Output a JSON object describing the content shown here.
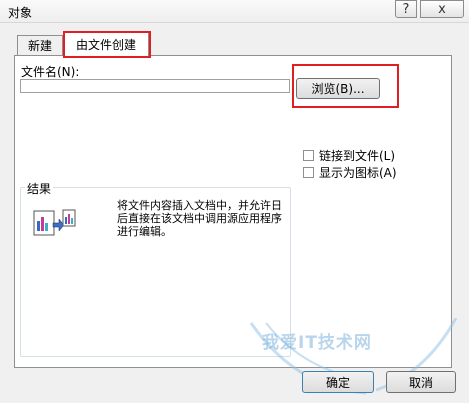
{
  "window": {
    "title": "对象",
    "help_label": "?",
    "close_label": "x"
  },
  "tabs": [
    {
      "label": "新建"
    },
    {
      "label": "由文件创建"
    }
  ],
  "file": {
    "label": "文件名(N):",
    "value": "",
    "browse_label": "浏览(B)..."
  },
  "options": {
    "link_label": "链接到文件(L)",
    "icon_label": "显示为图标(A)"
  },
  "result": {
    "title": "结果",
    "text": "将文件内容插入文档中，并允许日后直接在该文档中调用源应用程序进行编辑。"
  },
  "buttons": {
    "ok_label": "确定",
    "cancel_label": "取消"
  },
  "watermark": "我爱IT技术网",
  "colors": {
    "highlight": "#e02020",
    "panel": "#ffffff",
    "dialog": "#f0f0f0"
  }
}
